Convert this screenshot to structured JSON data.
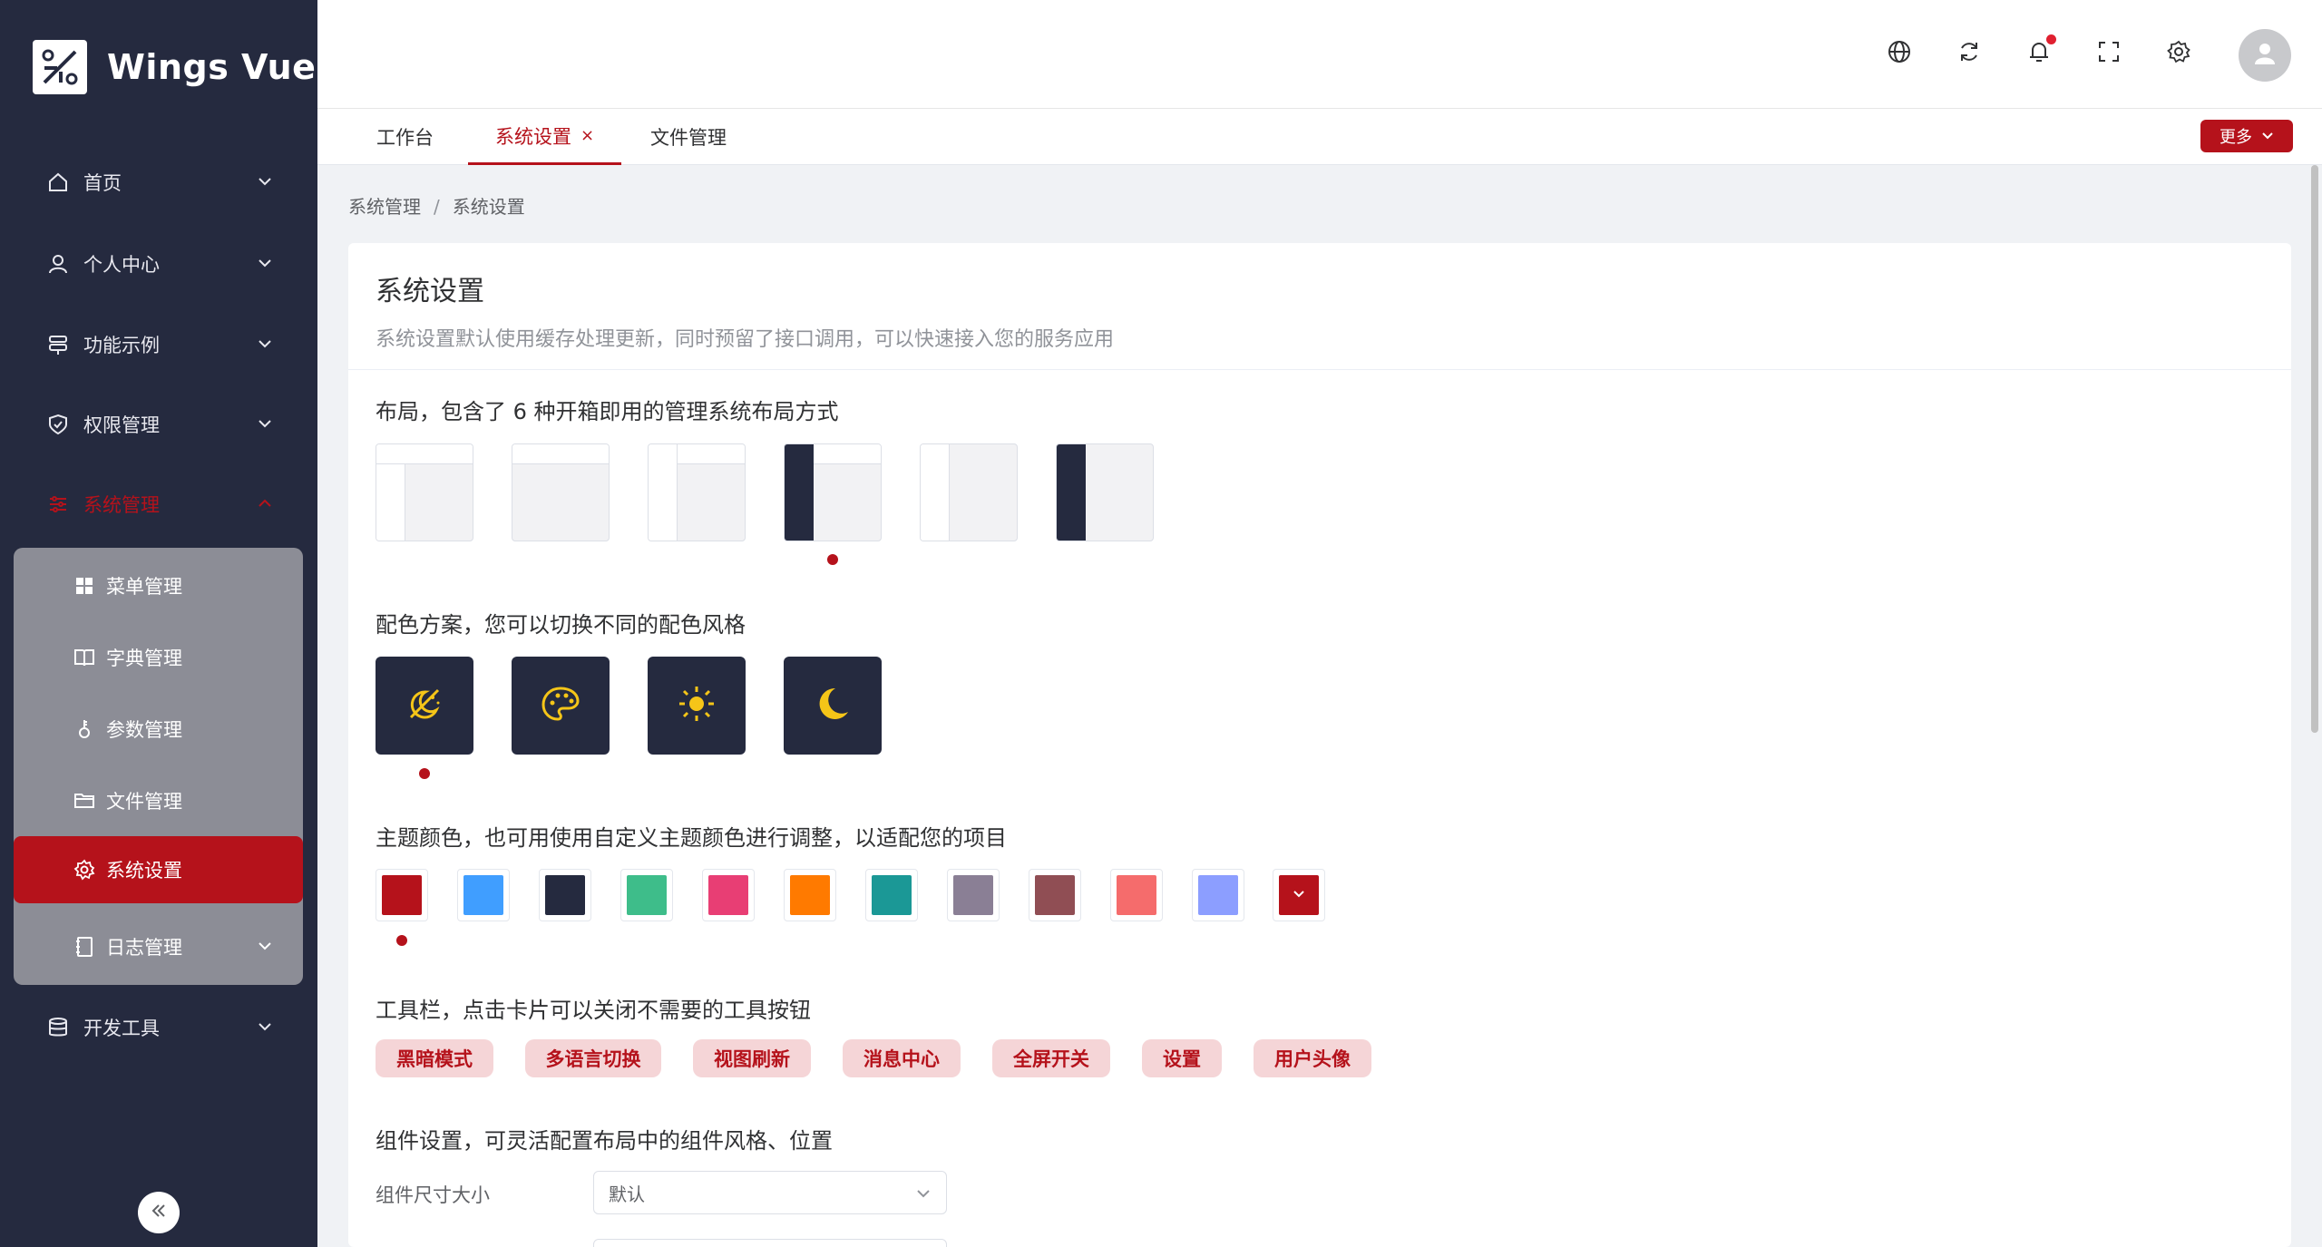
{
  "app": {
    "title": "Wings Vue"
  },
  "sidebar": {
    "items": [
      {
        "label": "首页",
        "icon": "home-icon"
      },
      {
        "label": "个人中心",
        "icon": "user-icon"
      },
      {
        "label": "功能示例",
        "icon": "stack-icon"
      },
      {
        "label": "权限管理",
        "icon": "shield-icon"
      },
      {
        "label": "系统管理",
        "icon": "sliders-icon"
      },
      {
        "label": "开发工具",
        "icon": "database-icon"
      }
    ],
    "submenu": [
      {
        "label": "菜单管理",
        "icon": "grid-icon"
      },
      {
        "label": "字典管理",
        "icon": "book-icon"
      },
      {
        "label": "参数管理",
        "icon": "key-icon"
      },
      {
        "label": "文件管理",
        "icon": "folder-icon"
      },
      {
        "label": "系统设置",
        "icon": "gear-icon"
      },
      {
        "label": "日志管理",
        "icon": "notebook-icon"
      }
    ]
  },
  "tabs": [
    {
      "label": "工作台"
    },
    {
      "label": "系统设置",
      "close": "×"
    },
    {
      "label": "文件管理"
    }
  ],
  "more_button": "更多",
  "breadcrumb": {
    "parent": "系统管理",
    "sep": "/",
    "current": "系统设置"
  },
  "card": {
    "title": "系统设置",
    "description": "系统设置默认使用缓存处理更新，同时预留了接口调用，可以快速接入您的服务应用"
  },
  "sections": {
    "layout": "布局，包含了 6 种开箱即用的管理系统布局方式",
    "scheme": "配色方案，您可以切换不同的配色风格",
    "theme": "主题颜色，也可用使用自定义主题颜色进行调整，以适配您的项目",
    "toolbar": "工具栏，点击卡片可以关闭不需要的工具按钮",
    "components": "组件设置，可灵活配置布局中的组件风格、位置"
  },
  "layout_selected_index": 3,
  "scheme_selected_index": 0,
  "theme_colors": [
    "#b5121b",
    "#409eff",
    "#252a3f",
    "#3ebd8a",
    "#e83e74",
    "#ff7a00",
    "#1b9896",
    "#8a7f95",
    "#904e54",
    "#f56c6c",
    "#8c9eff"
  ],
  "theme_selected_index": 0,
  "toolbar_chips": [
    "黑暗模式",
    "多语言切换",
    "视图刷新",
    "消息中心",
    "全屏开关",
    "设置",
    "用户头像"
  ],
  "form": {
    "size_label": "组件尺寸大小",
    "size_value": "默认"
  },
  "colors": {
    "accent": "#b5121b",
    "sidebar": "#252a3f",
    "submenu_bg": "#8c8d96"
  }
}
